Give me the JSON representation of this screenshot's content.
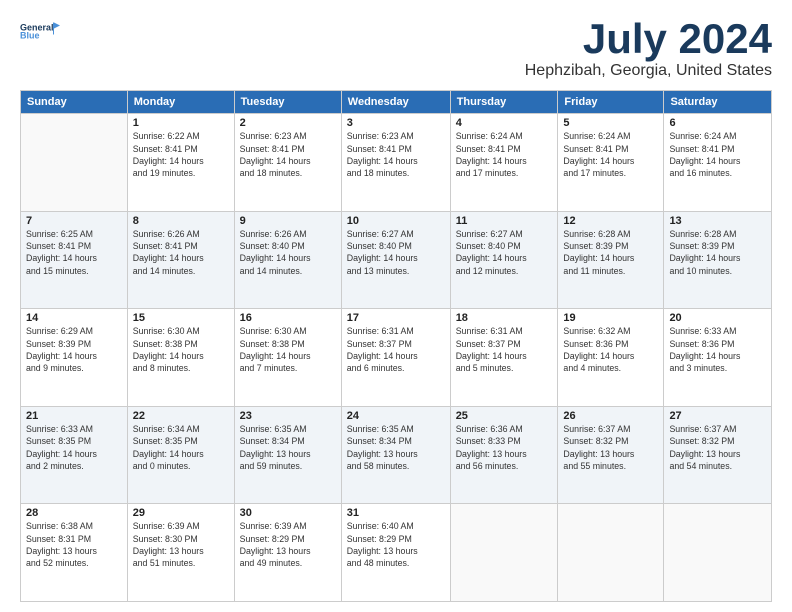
{
  "logo": {
    "line1": "General",
    "line2": "Blue"
  },
  "title": "July 2024",
  "subtitle": "Hephzibah, Georgia, United States",
  "weekdays": [
    "Sunday",
    "Monday",
    "Tuesday",
    "Wednesday",
    "Thursday",
    "Friday",
    "Saturday"
  ],
  "weeks": [
    [
      {
        "num": "",
        "sunrise": "",
        "sunset": "",
        "daylight": ""
      },
      {
        "num": "1",
        "sunrise": "6:22 AM",
        "sunset": "8:41 PM",
        "daylight": "14 hours and 19 minutes."
      },
      {
        "num": "2",
        "sunrise": "6:23 AM",
        "sunset": "8:41 PM",
        "daylight": "14 hours and 18 minutes."
      },
      {
        "num": "3",
        "sunrise": "6:23 AM",
        "sunset": "8:41 PM",
        "daylight": "14 hours and 18 minutes."
      },
      {
        "num": "4",
        "sunrise": "6:24 AM",
        "sunset": "8:41 PM",
        "daylight": "14 hours and 17 minutes."
      },
      {
        "num": "5",
        "sunrise": "6:24 AM",
        "sunset": "8:41 PM",
        "daylight": "14 hours and 17 minutes."
      },
      {
        "num": "6",
        "sunrise": "6:24 AM",
        "sunset": "8:41 PM",
        "daylight": "14 hours and 16 minutes."
      }
    ],
    [
      {
        "num": "7",
        "sunrise": "6:25 AM",
        "sunset": "8:41 PM",
        "daylight": "14 hours and 15 minutes."
      },
      {
        "num": "8",
        "sunrise": "6:26 AM",
        "sunset": "8:41 PM",
        "daylight": "14 hours and 14 minutes."
      },
      {
        "num": "9",
        "sunrise": "6:26 AM",
        "sunset": "8:40 PM",
        "daylight": "14 hours and 14 minutes."
      },
      {
        "num": "10",
        "sunrise": "6:27 AM",
        "sunset": "8:40 PM",
        "daylight": "14 hours and 13 minutes."
      },
      {
        "num": "11",
        "sunrise": "6:27 AM",
        "sunset": "8:40 PM",
        "daylight": "14 hours and 12 minutes."
      },
      {
        "num": "12",
        "sunrise": "6:28 AM",
        "sunset": "8:39 PM",
        "daylight": "14 hours and 11 minutes."
      },
      {
        "num": "13",
        "sunrise": "6:28 AM",
        "sunset": "8:39 PM",
        "daylight": "14 hours and 10 minutes."
      }
    ],
    [
      {
        "num": "14",
        "sunrise": "6:29 AM",
        "sunset": "8:39 PM",
        "daylight": "14 hours and 9 minutes."
      },
      {
        "num": "15",
        "sunrise": "6:30 AM",
        "sunset": "8:38 PM",
        "daylight": "14 hours and 8 minutes."
      },
      {
        "num": "16",
        "sunrise": "6:30 AM",
        "sunset": "8:38 PM",
        "daylight": "14 hours and 7 minutes."
      },
      {
        "num": "17",
        "sunrise": "6:31 AM",
        "sunset": "8:37 PM",
        "daylight": "14 hours and 6 minutes."
      },
      {
        "num": "18",
        "sunrise": "6:31 AM",
        "sunset": "8:37 PM",
        "daylight": "14 hours and 5 minutes."
      },
      {
        "num": "19",
        "sunrise": "6:32 AM",
        "sunset": "8:36 PM",
        "daylight": "14 hours and 4 minutes."
      },
      {
        "num": "20",
        "sunrise": "6:33 AM",
        "sunset": "8:36 PM",
        "daylight": "14 hours and 3 minutes."
      }
    ],
    [
      {
        "num": "21",
        "sunrise": "6:33 AM",
        "sunset": "8:35 PM",
        "daylight": "14 hours and 2 minutes."
      },
      {
        "num": "22",
        "sunrise": "6:34 AM",
        "sunset": "8:35 PM",
        "daylight": "14 hours and 0 minutes."
      },
      {
        "num": "23",
        "sunrise": "6:35 AM",
        "sunset": "8:34 PM",
        "daylight": "13 hours and 59 minutes."
      },
      {
        "num": "24",
        "sunrise": "6:35 AM",
        "sunset": "8:34 PM",
        "daylight": "13 hours and 58 minutes."
      },
      {
        "num": "25",
        "sunrise": "6:36 AM",
        "sunset": "8:33 PM",
        "daylight": "13 hours and 56 minutes."
      },
      {
        "num": "26",
        "sunrise": "6:37 AM",
        "sunset": "8:32 PM",
        "daylight": "13 hours and 55 minutes."
      },
      {
        "num": "27",
        "sunrise": "6:37 AM",
        "sunset": "8:32 PM",
        "daylight": "13 hours and 54 minutes."
      }
    ],
    [
      {
        "num": "28",
        "sunrise": "6:38 AM",
        "sunset": "8:31 PM",
        "daylight": "13 hours and 52 minutes."
      },
      {
        "num": "29",
        "sunrise": "6:39 AM",
        "sunset": "8:30 PM",
        "daylight": "13 hours and 51 minutes."
      },
      {
        "num": "30",
        "sunrise": "6:39 AM",
        "sunset": "8:29 PM",
        "daylight": "13 hours and 49 minutes."
      },
      {
        "num": "31",
        "sunrise": "6:40 AM",
        "sunset": "8:29 PM",
        "daylight": "13 hours and 48 minutes."
      },
      {
        "num": "",
        "sunrise": "",
        "sunset": "",
        "daylight": ""
      },
      {
        "num": "",
        "sunrise": "",
        "sunset": "",
        "daylight": ""
      },
      {
        "num": "",
        "sunrise": "",
        "sunset": "",
        "daylight": ""
      }
    ]
  ]
}
